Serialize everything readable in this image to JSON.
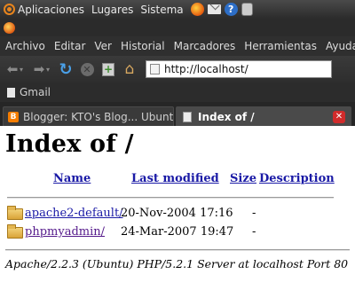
{
  "gnome_panel": {
    "menus": [
      "Aplicaciones",
      "Lugares",
      "Sistema"
    ],
    "help_glyph": "?"
  },
  "browser": {
    "menu_bar": [
      "Archivo",
      "Editar",
      "Ver",
      "Historial",
      "Marcadores",
      "Herramientas",
      "Ayuda"
    ],
    "nav_glyphs": {
      "back": "⬅",
      "forward": "➡",
      "dropdown": "▾",
      "reload": "↻",
      "stop": "✕",
      "new_tab": "+",
      "home": "⌂"
    },
    "url": "http://localhost/",
    "bookmarks": [
      "Gmail"
    ],
    "tabs": [
      {
        "label": "Blogger: KTO's Blog... Ubunt...",
        "favicon": "B",
        "active": false
      },
      {
        "label": "Index of /",
        "active": true,
        "close": "✕"
      }
    ]
  },
  "page": {
    "title": "Index of /",
    "columns": [
      "Name",
      "Last modified",
      "Size",
      "Description"
    ],
    "entries": [
      {
        "name": "apache2-default/",
        "modified": "20-Nov-2004 17:16",
        "size": "-"
      },
      {
        "name": "phpmyadmin/",
        "modified": "24-Mar-2007 19:47",
        "size": "-"
      }
    ],
    "server_signature": "Apache/2.2.3 (Ubuntu) PHP/5.2.1 Server at localhost Port 80"
  },
  "colors": {
    "panel_bg": "#2b2b2b",
    "link": "#1a1aa6",
    "visited_link": "#551a8b",
    "tab_close": "#d12b2b",
    "ubuntu_orange": "#e9851d"
  }
}
